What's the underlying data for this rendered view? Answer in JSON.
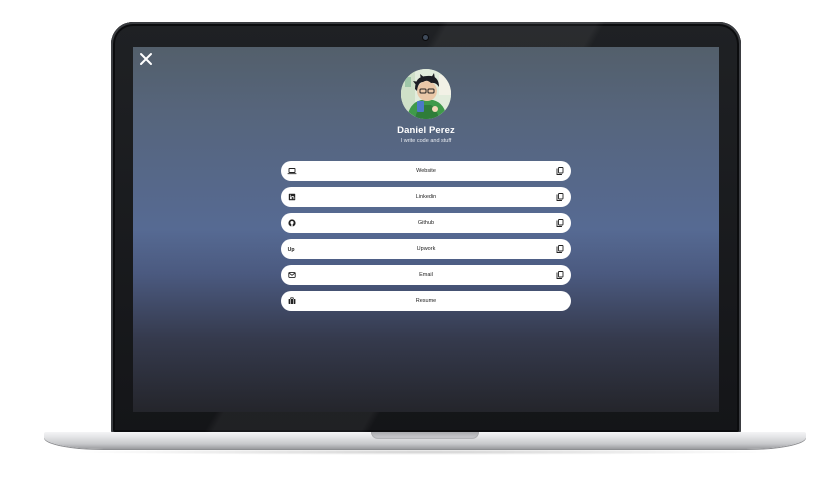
{
  "profile": {
    "name": "Daniel Perez",
    "tagline": "I write code and stuff"
  },
  "links": [
    {
      "label": "Website",
      "icon": "laptop-icon",
      "copyable": true
    },
    {
      "label": "Linkedin",
      "icon": "linkedin-icon",
      "copyable": true
    },
    {
      "label": "Github",
      "icon": "github-icon",
      "copyable": true
    },
    {
      "label": "Upwork",
      "icon": "upwork-icon",
      "copyable": true
    },
    {
      "label": "Email",
      "icon": "email-icon",
      "copyable": true
    },
    {
      "label": "Resume",
      "icon": "briefcase-icon",
      "copyable": false
    }
  ],
  "upwork_icon_text": "Up",
  "colors": {
    "screen_top": "#535f6b",
    "screen_mid": "#566a93",
    "screen_bottom": "#24252b",
    "button_bg": "#ffffff",
    "text_on_screen": "#ffffff"
  }
}
